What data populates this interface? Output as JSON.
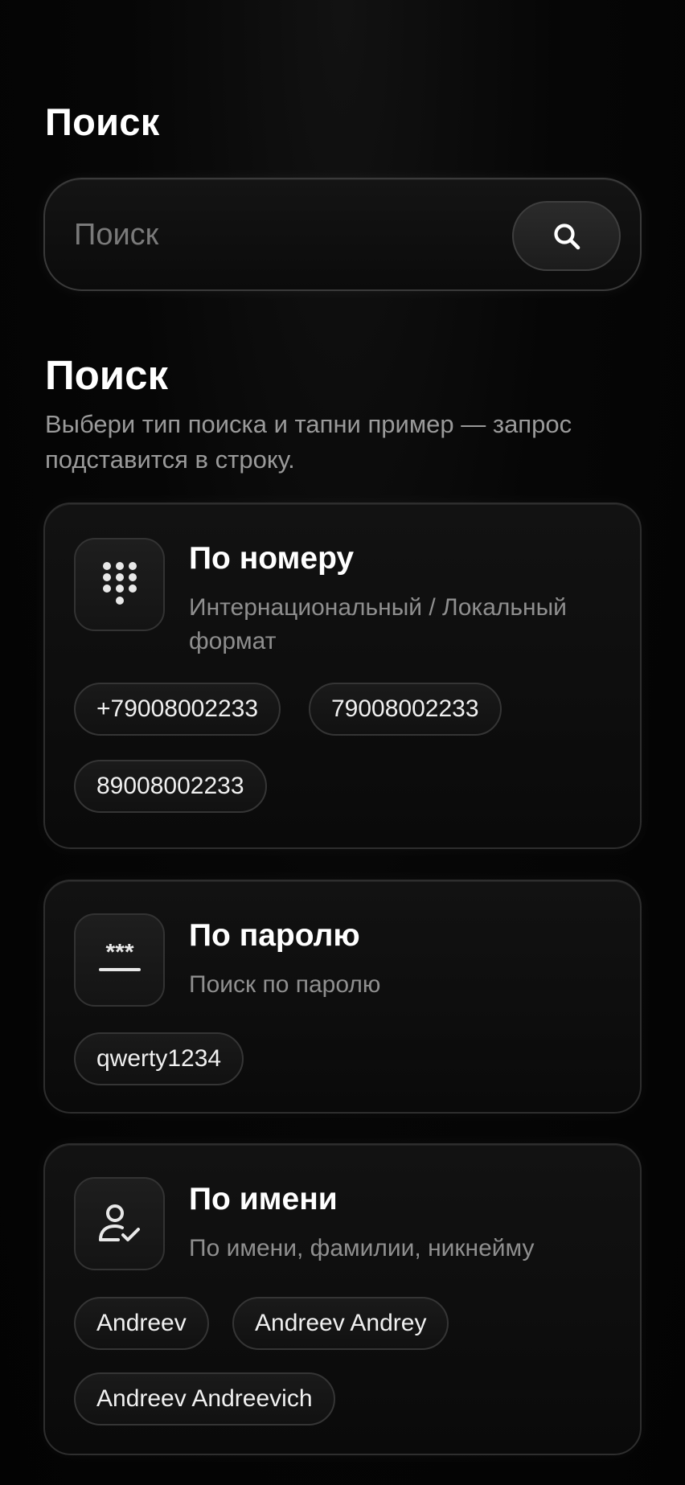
{
  "header": {
    "title": "Поиск"
  },
  "search": {
    "placeholder": "Поиск",
    "value": ""
  },
  "section": {
    "title": "Поиск",
    "description": "Выбери тип поиска и тапни пример — запрос подставится в строку."
  },
  "cards": [
    {
      "icon": "dialpad-icon",
      "title": "По номеру",
      "subtitle": "Интернациональный / Локальный формат",
      "examples": [
        "+79008002233",
        "79008002233",
        "89008002233"
      ]
    },
    {
      "icon": "password-icon",
      "title": "По паролю",
      "subtitle": "Поиск по паролю",
      "examples": [
        "qwerty1234"
      ]
    },
    {
      "icon": "user-check-icon",
      "title": "По имени",
      "subtitle": "По имени, фамилии, никнейму",
      "examples": [
        "Andreev",
        "Andreev Andrey",
        "Andreev Andreevich"
      ]
    }
  ],
  "colors": {
    "background": "#050505",
    "card": "#111111",
    "border": "#2e2e2e",
    "text": "#ffffff",
    "muted": "#8f8f8f"
  }
}
